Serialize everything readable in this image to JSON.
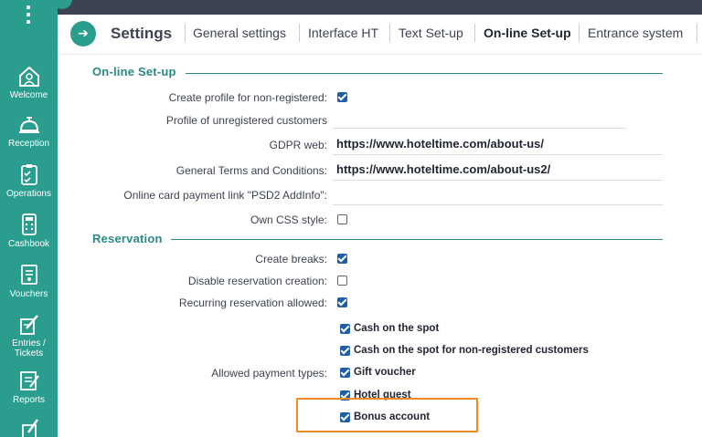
{
  "sidebar": {
    "items": [
      {
        "label": "Welcome",
        "icon": "home-icon"
      },
      {
        "label": "Reception",
        "icon": "bell-icon"
      },
      {
        "label": "Operations",
        "icon": "clipboard-icon"
      },
      {
        "label": "Cashbook",
        "icon": "calculator-icon"
      },
      {
        "label": "Vouchers",
        "icon": "voucher-icon"
      },
      {
        "label": "Entries /\nTickets",
        "icon": "pencil-icon"
      },
      {
        "label": "Reports",
        "icon": "report-icon"
      }
    ]
  },
  "header": {
    "title": "Settings",
    "tabs": [
      {
        "label": "General settings",
        "active": false
      },
      {
        "label": "Interface HT",
        "active": false
      },
      {
        "label": "Text Set-up",
        "active": false
      },
      {
        "label": "On-line Set-up",
        "active": true
      },
      {
        "label": "Entrance system",
        "active": false
      }
    ]
  },
  "online_setup": {
    "title": "On-line Set-up",
    "create_profile_label": "Create profile for non-registered:",
    "create_profile_checked": true,
    "profile_unregistered_label": "Profile of unregistered customers",
    "profile_unregistered_value": "",
    "gdpr_label": "GDPR web:",
    "gdpr_value": "https://www.hoteltime.com/about-us/",
    "terms_label": "General Terms and Conditions:",
    "terms_value": "https://www.hoteltime.com/about-us2/",
    "card_link_label": "Online card payment link \"PSD2 AddInfo\":",
    "card_link_value": "",
    "css_label": "Own CSS style:",
    "css_checked": false
  },
  "reservation": {
    "title": "Reservation",
    "create_breaks_label": "Create breaks:",
    "create_breaks_checked": true,
    "disable_creation_label": "Disable reservation creation:",
    "disable_creation_checked": false,
    "recurring_label": "Recurring reservation allowed:",
    "recurring_checked": true,
    "payment_types_label": "Allowed payment types:",
    "payment_types": [
      {
        "label": "Cash on the spot",
        "checked": true
      },
      {
        "label": "Cash on the spot for non-registered customers",
        "checked": true
      },
      {
        "label": "Gift voucher",
        "checked": true
      },
      {
        "label": "Hotel guest",
        "checked": true
      },
      {
        "label": "Bonus account",
        "checked": true
      }
    ]
  },
  "colors": {
    "sidebar": "#2a9d8f",
    "accent_section": "#2a8a86",
    "checkbox": "#1f5fa8",
    "highlight": "#f08a24"
  }
}
